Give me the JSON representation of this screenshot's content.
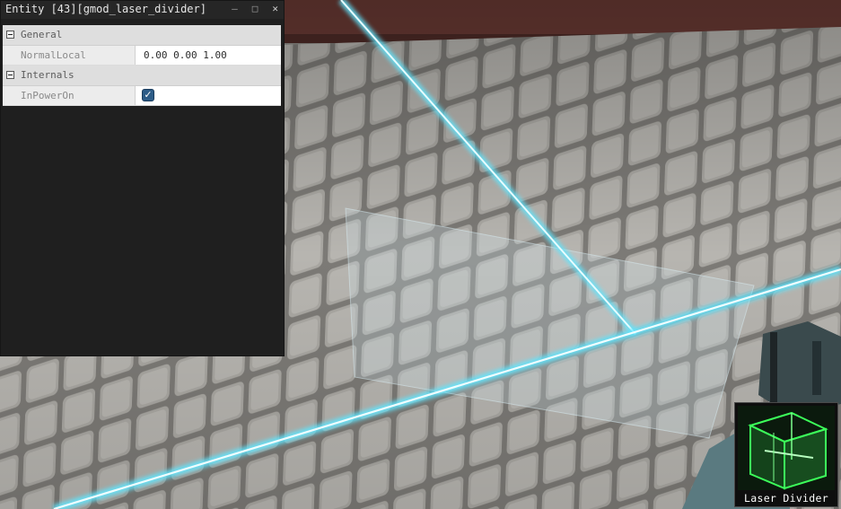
{
  "window": {
    "title": "Entity [43][gmod_laser_divider]",
    "minimize_glyph": "—",
    "maximize_glyph": "□",
    "close_glyph": "✕"
  },
  "properties": {
    "categories": [
      {
        "label": "General",
        "expanded": true,
        "rows": [
          {
            "name": "NormalLocal",
            "value": "0.00 0.00 1.00",
            "type": "text"
          }
        ]
      },
      {
        "label": "Internals",
        "expanded": true,
        "rows": [
          {
            "name": "InPowerOn",
            "value": true,
            "type": "checkbox"
          }
        ]
      }
    ]
  },
  "tool": {
    "label": "Laser Divider",
    "icon": "laser-divider-icon"
  },
  "colors": {
    "laser": "#5fe6ff",
    "icon_green": "#3cff5a",
    "panel_bg": "#1f1f1f",
    "checkbox": "#2d5c87"
  }
}
